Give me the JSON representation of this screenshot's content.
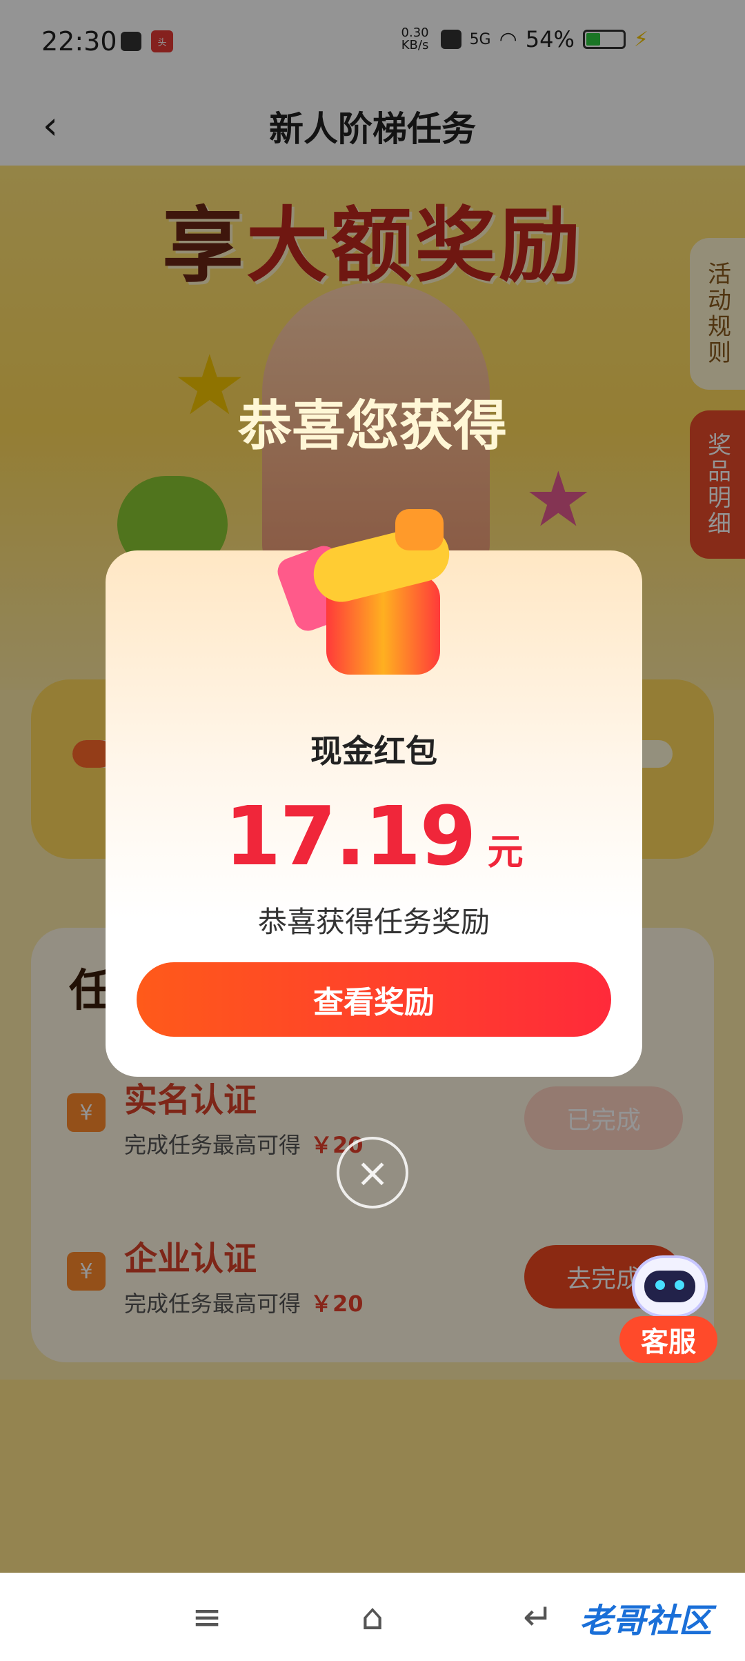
{
  "status_bar": {
    "time": "22:30",
    "net_speed": "0.30 KB/s",
    "network": "5G",
    "battery": "54%"
  },
  "nav": {
    "title": "新人阶梯任务"
  },
  "hero": {
    "title_part1": "享",
    "title_part2": "大额奖励",
    "congrats": "恭喜您获得"
  },
  "side_tabs": {
    "rules": "活动规则",
    "prizes": "奖品明细"
  },
  "tasks": [
    {
      "name": "实名认证",
      "desc": "完成任务最高可得",
      "amount": "￥20",
      "button": "已完成"
    },
    {
      "name": "企业认证",
      "desc": "完成任务最高可得",
      "amount": "￥20",
      "button": "去完成"
    }
  ],
  "modal": {
    "prize_name": "现金红包",
    "amount": "17.19",
    "unit": "元",
    "message": "恭喜获得任务奖励",
    "button": "查看奖励"
  },
  "close_icon": "×",
  "customer_service": "客服",
  "watermark": "老哥社区",
  "colors": {
    "accent": "#f0263a",
    "button_gradient_start": "#ff5a1a",
    "button_gradient_end": "#ff2a3a"
  }
}
